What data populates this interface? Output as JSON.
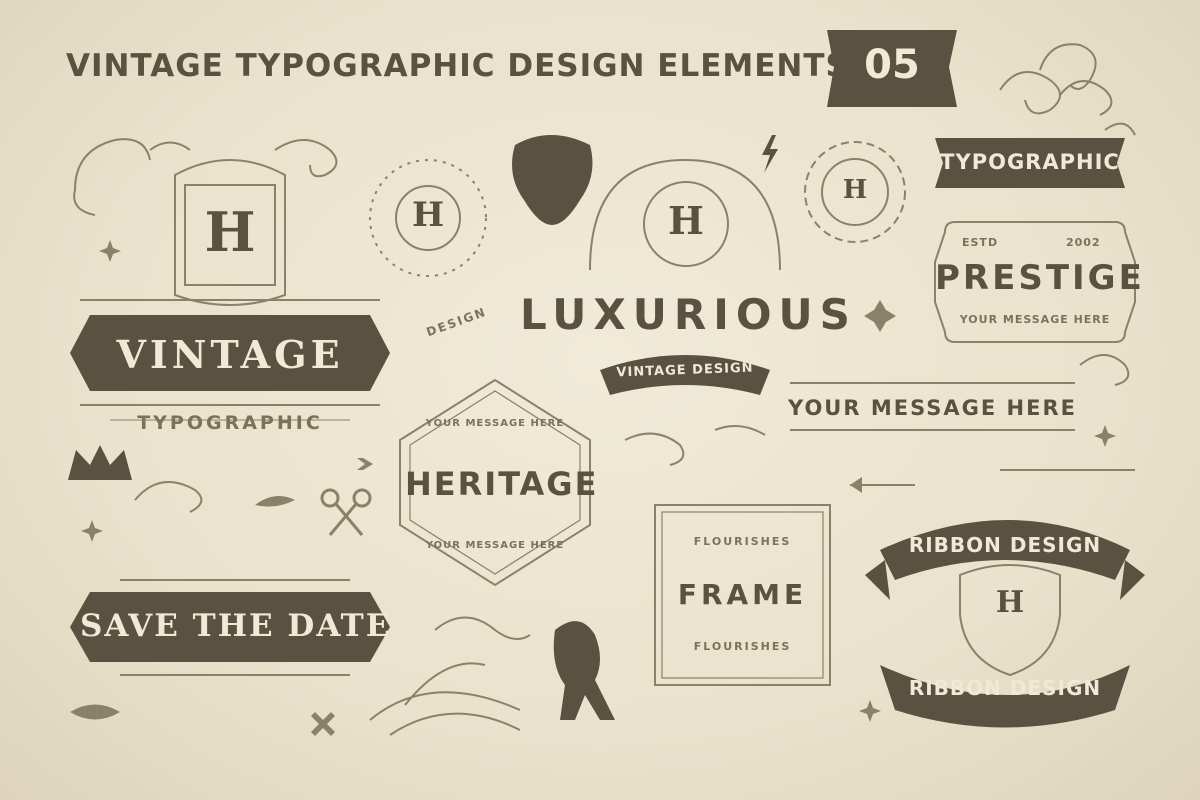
{
  "header": {
    "title": "VINTAGE TYPOGRAPHIC DESIGN ELEMENTS",
    "number": "05"
  },
  "colors": {
    "background": "#ece6d3",
    "ink_dark": "#5a5140",
    "ink_mid": "#8a8268",
    "cream": "#efe9d6"
  },
  "badges": {
    "monogram_letter": "H",
    "vintage": "VINTAGE",
    "typographic_small": "TYPOGRAPHIC",
    "design_ribbon": "DESIGN",
    "luxurious": "LUXURIOUS",
    "vintage_design": "VINTAGE DESIGN",
    "your_message_here": "YOUR MESSAGE HERE",
    "heritage": "HERITAGE",
    "heritage_top": "YOUR MESSAGE HERE",
    "heritage_bottom": "YOUR MESSAGE HERE",
    "typographic_banner": "TYPOGRAPHIC",
    "estd": "ESTD",
    "year": "2002",
    "prestige": "PRESTIGE",
    "prestige_sub": "YOUR MESSAGE HERE",
    "save_the_date": "SAVE THE DATE",
    "frame": "FRAME",
    "flourishes_top": "FLOURISHES",
    "flourishes_bottom": "FLOURISHES",
    "ribbon_top": "RIBBON DESIGN",
    "ribbon_bottom": "RIBBON DESIGN"
  },
  "icons": [
    "panther-head-icon",
    "crown-icon",
    "lion-icon",
    "arrow-icon",
    "crossed-keys-icon",
    "laurel-wreath-icon",
    "lightning-icon",
    "sparkle-icon",
    "flourish-icon"
  ]
}
